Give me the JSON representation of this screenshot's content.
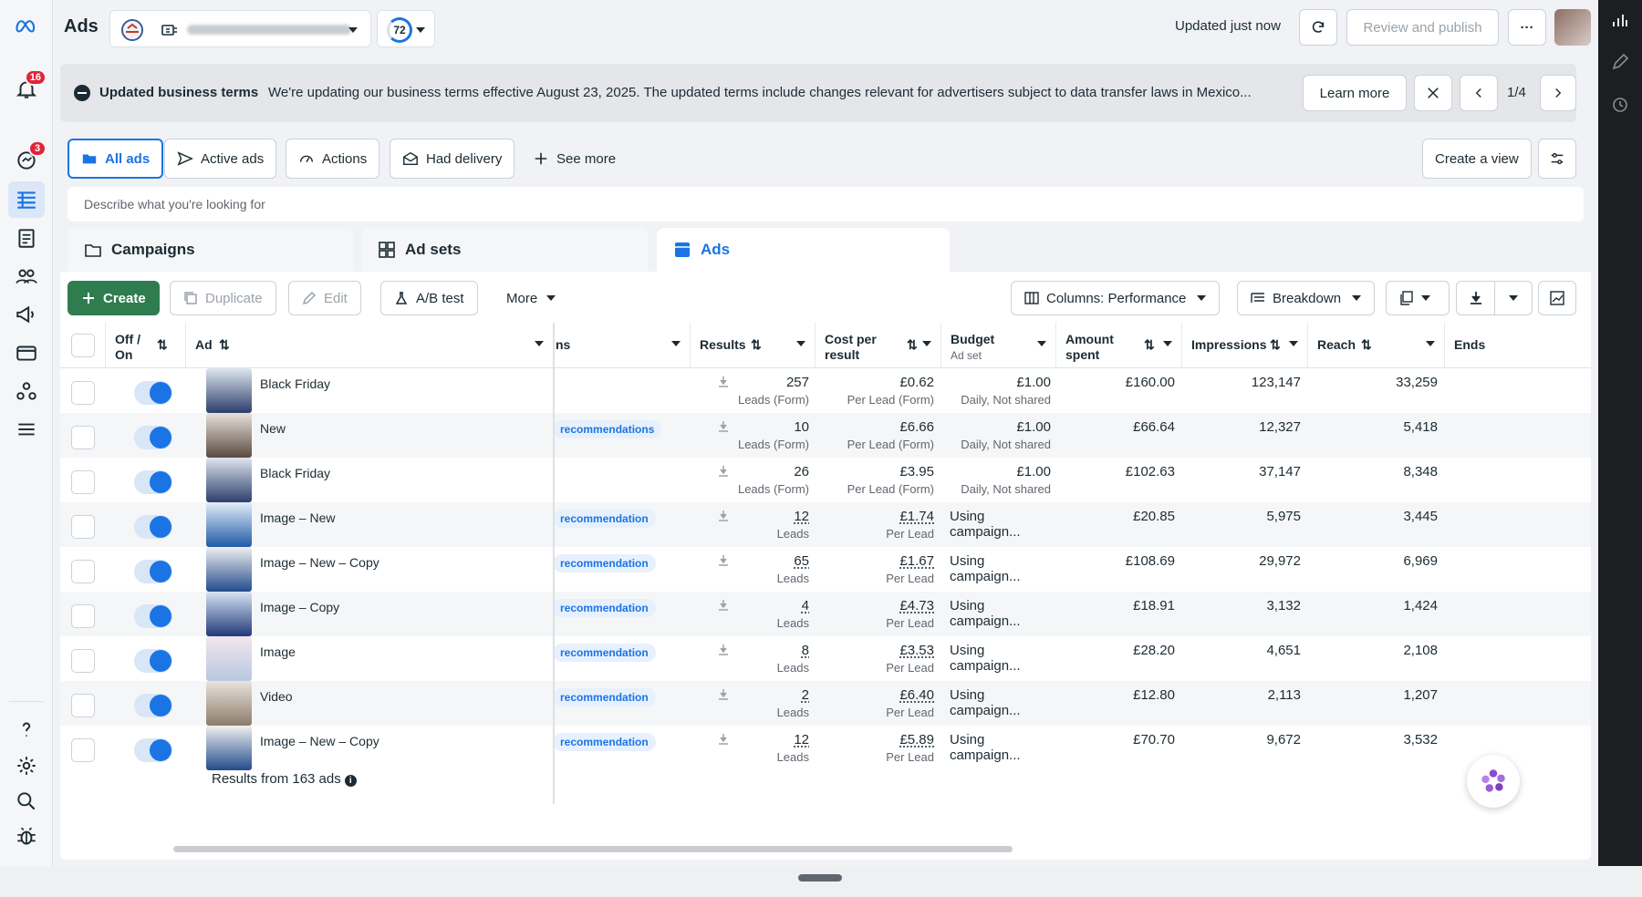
{
  "app": {
    "title": "Ads",
    "updated": "Updated just now",
    "review_publish": "Review and publish",
    "score": "72",
    "more_dots": "···"
  },
  "nav": {
    "notifications_badge": "16",
    "messages_badge": "3"
  },
  "banner": {
    "title": "Updated business terms",
    "text": "We're updating our business terms effective August 23, 2025. The updated terms include changes relevant for advertisers subject to data transfer laws in Mexico...",
    "learn_more": "Learn more",
    "pager": "1/4"
  },
  "views": {
    "all_ads": "All ads",
    "active_ads": "Active ads",
    "actions": "Actions",
    "had_delivery": "Had delivery",
    "see_more": "See more",
    "create_view": "Create a view"
  },
  "search": {
    "placeholder": "Describe what you're looking for"
  },
  "tabs": {
    "campaigns": "Campaigns",
    "adsets": "Ad sets",
    "ads": "Ads"
  },
  "toolbar": {
    "create": "Create",
    "duplicate": "Duplicate",
    "edit": "Edit",
    "ab_test": "A/B test",
    "more": "More",
    "columns": "Columns: Performance",
    "breakdown": "Breakdown"
  },
  "table": {
    "headers": {
      "off_on": "Off / On",
      "ad": "Ad",
      "recs": "ns",
      "results": "Results",
      "cost": "Cost per result",
      "budget": "Budget",
      "budget_sub": "Ad set",
      "amount": "Amount spent",
      "impressions": "Impressions",
      "reach": "Reach",
      "ends": "Ends"
    },
    "rows": [
      {
        "name": "Black Friday",
        "rec": "",
        "results": "257",
        "results_type": "Leads (Form)",
        "cost": "£0.62",
        "cost_type": "Per Lead (Form)",
        "budget": "£1.00",
        "budget_type": "Daily, Not shared",
        "amount": "£160.00",
        "impressions": "123,147",
        "reach": "33,259"
      },
      {
        "name": "New",
        "rec": "recommendations",
        "results": "10",
        "results_type": "Leads (Form)",
        "cost": "£6.66",
        "cost_type": "Per Lead (Form)",
        "budget": "£1.00",
        "budget_type": "Daily, Not shared",
        "amount": "£66.64",
        "impressions": "12,327",
        "reach": "5,418"
      },
      {
        "name": "Black Friday",
        "rec": "",
        "results": "26",
        "results_type": "Leads (Form)",
        "cost": "£3.95",
        "cost_type": "Per Lead (Form)",
        "budget": "£1.00",
        "budget_type": "Daily, Not shared",
        "amount": "£102.63",
        "impressions": "37,147",
        "reach": "8,348"
      },
      {
        "name": "Image – New",
        "rec": "recommendation",
        "results": "12",
        "results_type": "Leads",
        "cost": "£1.74",
        "cost_type": "Per Lead",
        "budget": "Using campaign...",
        "budget_type": "",
        "amount": "£20.85",
        "impressions": "5,975",
        "reach": "3,445"
      },
      {
        "name": "Image – New – Copy",
        "rec": "recommendation",
        "results": "65",
        "results_type": "Leads",
        "cost": "£1.67",
        "cost_type": "Per Lead",
        "budget": "Using campaign...",
        "budget_type": "",
        "amount": "£108.69",
        "impressions": "29,972",
        "reach": "6,969"
      },
      {
        "name": "Image – Copy",
        "rec": "recommendation",
        "results": "4",
        "results_type": "Leads",
        "cost": "£4.73",
        "cost_type": "Per Lead",
        "budget": "Using campaign...",
        "budget_type": "",
        "amount": "£18.91",
        "impressions": "3,132",
        "reach": "1,424"
      },
      {
        "name": "Image",
        "rec": "recommendation",
        "results": "8",
        "results_type": "Leads",
        "cost": "£3.53",
        "cost_type": "Per Lead",
        "budget": "Using campaign...",
        "budget_type": "",
        "amount": "£28.20",
        "impressions": "4,651",
        "reach": "2,108"
      },
      {
        "name": "Video",
        "rec": "recommendation",
        "results": "2",
        "results_type": "Leads",
        "cost": "£6.40",
        "cost_type": "Per Lead",
        "budget": "Using campaign...",
        "budget_type": "",
        "amount": "£12.80",
        "impressions": "2,113",
        "reach": "1,207"
      },
      {
        "name": "Image – New – Copy",
        "rec": "recommendation",
        "results": "12",
        "results_type": "Leads",
        "cost": "£5.89",
        "cost_type": "Per Lead",
        "budget": "Using campaign...",
        "budget_type": "",
        "amount": "£70.70",
        "impressions": "9,672",
        "reach": "3,532"
      }
    ],
    "footer": "Results from 163 ads"
  },
  "colors": {
    "accent": "#1b74e4",
    "create_green": "#2f7d4f",
    "badge_red": "#e0243a"
  }
}
